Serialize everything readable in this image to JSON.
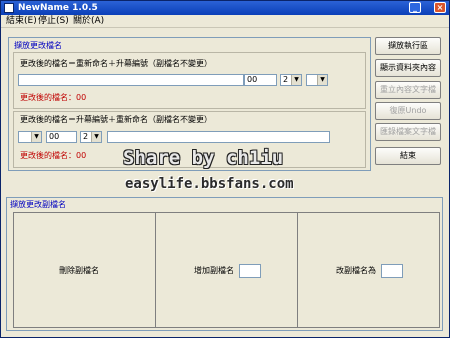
{
  "window": {
    "title": "NewName 1.0.5"
  },
  "menu": {
    "items": [
      "結束(E)",
      "停止(S)",
      "關於(A)"
    ]
  },
  "rename_group": {
    "label": "擷放更改檔名",
    "section1": {
      "formula": "更改後的檔名＝重新命名＋升幕編號（副檔名不變更）",
      "number_value": "00",
      "digits_value": "2",
      "order_value": "",
      "result_label": "更改後的檔名：00"
    },
    "section2": {
      "formula": "更改後的檔名＝升幕編號＋重新命名（副檔名不變更）",
      "order_value": "",
      "number_value": "00",
      "digits_value": "2",
      "result_label": "更改後的檔名：00"
    }
  },
  "buttons": {
    "start": "擷放執行區",
    "show_info": "顯示資料夾內容",
    "rename_apply": "重立內容文字檔",
    "undo": "復原Undo",
    "export": "匯錄檔案文字檔",
    "close": "結束"
  },
  "ext_group": {
    "label": "擷放更改副檔名",
    "delete_label": "刪除副檔名",
    "add_label": "增加副檔名",
    "add_value": "",
    "change_label": "改副檔名為",
    "change_value": ""
  },
  "watermark": {
    "line1": "Share by ch1iu",
    "line2": "easylife.bbsfans.com"
  },
  "colors": {
    "titlebar": "#2b62d6",
    "group_label": "#0000c0",
    "result_text": "#c00000"
  }
}
